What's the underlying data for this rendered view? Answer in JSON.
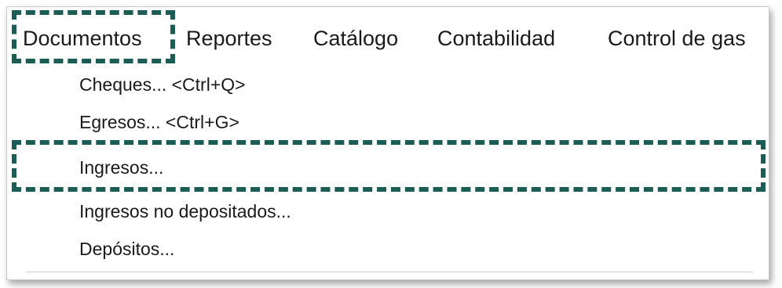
{
  "menubar": {
    "items": [
      {
        "label": "Documentos"
      },
      {
        "label": "Reportes"
      },
      {
        "label": "Catálogo"
      },
      {
        "label": "Contabilidad"
      },
      {
        "label": "Control de gas"
      }
    ]
  },
  "dropdown": {
    "items": [
      {
        "label": "Cheques... <Ctrl+Q>"
      },
      {
        "label": "Egresos... <Ctrl+G>"
      },
      {
        "label": "Ingresos..."
      },
      {
        "label": "Ingresos no depositados..."
      },
      {
        "label": "Depósitos..."
      }
    ]
  },
  "highlight_color": "#1b5c55"
}
